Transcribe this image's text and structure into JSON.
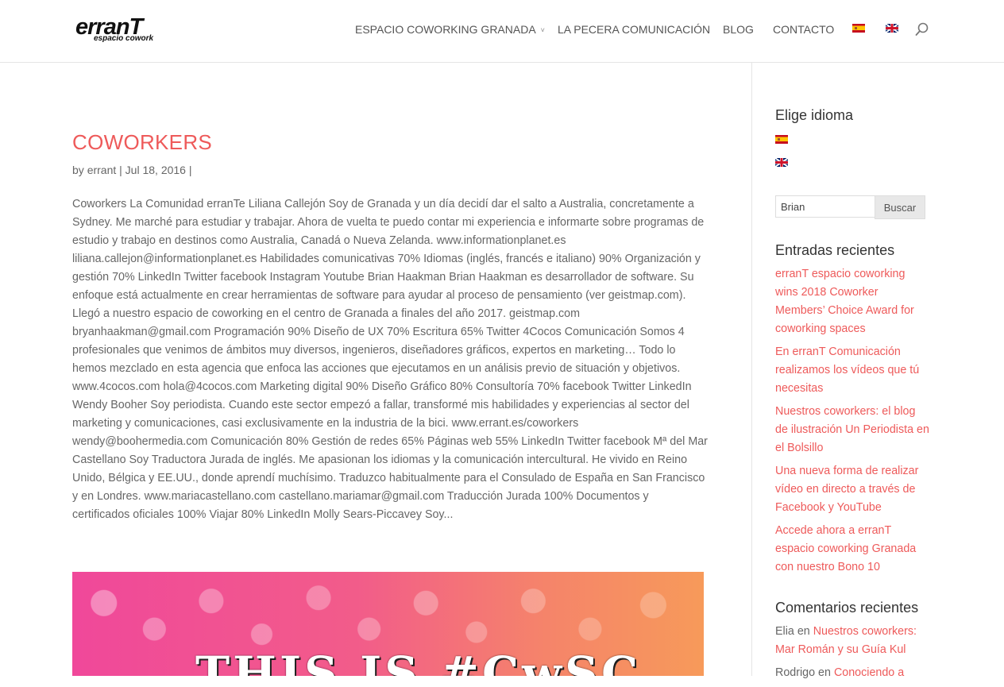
{
  "header": {
    "logo_main": "erranT",
    "logo_sub": "espacio cowork",
    "nav": [
      {
        "label": "ESPACIO COWORKING GRANADA",
        "chevron": "˅"
      },
      {
        "label": "LA PECERA COMUNICACIÓN"
      },
      {
        "label": "BLOG"
      },
      {
        "label": "CONTACTO"
      }
    ],
    "flags": [
      "spain-flag-icon",
      "uk-flag-icon"
    ],
    "search_icon": "search-icon"
  },
  "post": {
    "title": "COWORKERS",
    "meta_prefix": "by ",
    "author": "errant",
    "meta_rest": " | Jul 18, 2016 |",
    "excerpt": "Coworkers La Comunidad erranTe Liliana Callejón Soy de Granada y un día decidí dar el salto a Australia, concretamente a Sydney. Me marché para estudiar y trabajar. Ahora de vuelta te puedo contar mi experiencia e informarte sobre programas de estudio y trabajo en destinos como Australia, Canadá o Nueva Zelanda. www.informationplanet.es liliana.callejon@informationplanet.es Habilidades comunicativas 70% Idiomas (inglés, francés e italiano) 90% Organización y gestión 70% LinkedIn Twitter facebook Instagram Youtube Brian Haakman Brian Haakman es desarrollador de software. Su enfoque está actualmente en crear herramientas de software para ayudar al proceso de pensamiento (ver geistmap.com). Llegó a nuestro espacio de coworking en el centro de Granada a finales del año 2017. geistmap.com bryanhaakman@gmail.com Programación 90% Diseño de UX 70% Escritura 65% Twitter 4Cocos Comunicación Somos 4 profesionales que venimos de ámbitos muy diversos, ingenieros, diseñadores gráficos, expertos en marketing… Todo lo hemos mezclado en esta agencia que enfoca las acciones que ejecutamos en un análisis previo de situación y objetivos. www.4cocos.com hola@4cocos.com Marketing digital 90% Diseño Gráfico 80% Consultoría 70% facebook Twitter LinkedIn Wendy Booher Soy periodista. Cuando este sector empezó a fallar, transformé mis habilidades y experiencias al sector del marketing y comunicaciones, casi exclusivamente en la industria de la bici. www.errant.es/coworkers wendy@boohermedia.com Comunicación 80% Gestión de redes 65% Páginas web 55% LinkedIn Twitter facebook Mª del Mar Castellano Soy Traductora Jurada de inglés. Me apasionan los idiomas y la comunicación intercultural. He vivido en Reino Unido, Bélgica y EE.UU., donde aprendí muchísimo. Traduzco habitualmente para el Consulado de España en San Francisco y en Londres. www.mariacastellano.com castellano.mariamar@gmail.com Traducción Jurada 100% Documentos y certificados oficiales 100% Viajar 80% LinkedIn Molly Sears-Piccavey Soy...",
    "hero_text": "THIS IS #CwSC"
  },
  "sidebar": {
    "lang_title": "Elige idioma",
    "search_value": "Brian",
    "search_button": "Buscar",
    "recent_title": "Entradas recientes",
    "recent_posts": [
      "erranT espacio coworking wins 2018 Coworker Members’ Choice Award for coworking spaces",
      "En erranT Comunicación realizamos los vídeos que tú necesitas",
      "Nuestros coworkers: el blog de ilustración Un Periodista en el Bolsillo",
      "Una nueva forma de realizar vídeo en directo a través de Facebook y YouTube",
      "Accede ahora a erranT espacio coworking Granada con nuestro Bono 10"
    ],
    "comments_title": "Comentarios recientes",
    "comments": [
      {
        "author": "Elia",
        "sep": " en ",
        "link": "Nuestros coworkers: Mar Román y su Guía Kul"
      },
      {
        "author": "Rodrigo",
        "sep": " en ",
        "link": "Conociendo a"
      }
    ]
  },
  "colors": {
    "accent": "#ee5a5a",
    "text": "#666666",
    "heading": "#333333"
  }
}
